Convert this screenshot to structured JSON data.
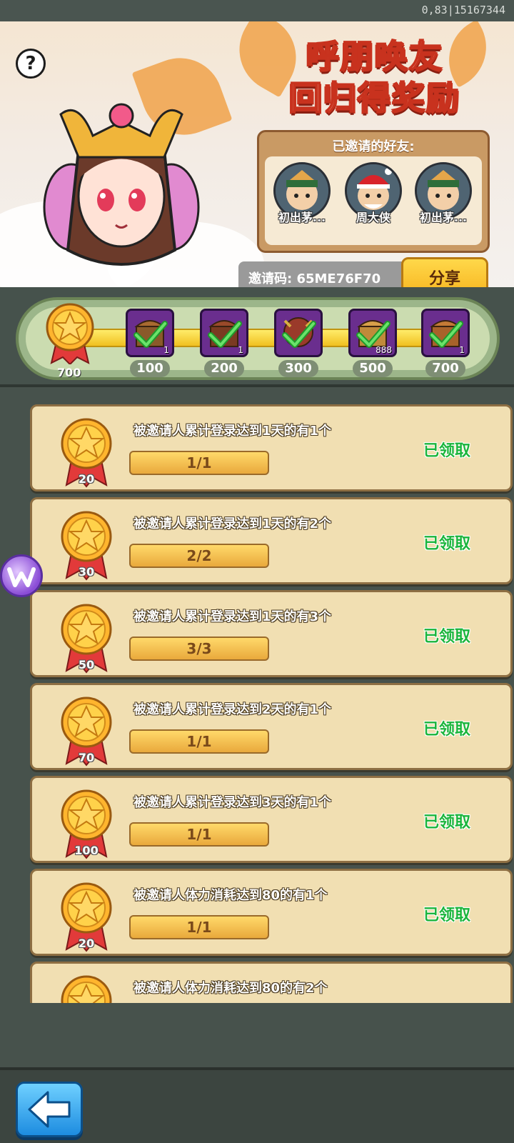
{
  "status_bar": {
    "text": "0,83|15167344"
  },
  "banner": {
    "help_label": "?",
    "title_line1": "呼朋唤友",
    "title_line2": "回归得奖励",
    "invited": {
      "title": "已邀请的好友:",
      "friends": [
        {
          "name": "初出茅..."
        },
        {
          "name": "周大侠"
        },
        {
          "name": "初出茅..."
        }
      ]
    },
    "invite_code": "邀请码: 65ME76F70",
    "share_label": "分享"
  },
  "progress": {
    "total_points": "700",
    "milestones": [
      {
        "points": "100",
        "count": "1",
        "claimed": true
      },
      {
        "points": "200",
        "count": "1",
        "claimed": true
      },
      {
        "points": "300",
        "count": "",
        "claimed": true
      },
      {
        "points": "500",
        "count": "888",
        "claimed": true
      },
      {
        "points": "700",
        "count": "1",
        "claimed": true
      }
    ]
  },
  "tasks": [
    {
      "desc": "被邀请人累计登录达到1天的有1个",
      "progress": "1/1",
      "reward": "20",
      "status": "已领取"
    },
    {
      "desc": "被邀请人累计登录达到1天的有2个",
      "progress": "2/2",
      "reward": "30",
      "status": "已领取"
    },
    {
      "desc": "被邀请人累计登录达到1天的有3个",
      "progress": "3/3",
      "reward": "50",
      "status": "已领取"
    },
    {
      "desc": "被邀请人累计登录达到2天的有1个",
      "progress": "1/1",
      "reward": "70",
      "status": "已领取"
    },
    {
      "desc": "被邀请人累计登录达到3天的有1个",
      "progress": "1/1",
      "reward": "100",
      "status": "已领取"
    },
    {
      "desc": "被邀请人体力消耗达到80的有1个",
      "progress": "1/1",
      "reward": "20",
      "status": "已领取"
    },
    {
      "desc": "被邀请人体力消耗达到80的有2个",
      "progress": "",
      "reward": "",
      "status": ""
    }
  ],
  "icons": {
    "help": "question-mark-icon",
    "medal": "star-medal-icon",
    "chest": "treasure-chest-icon",
    "check": "green-check-icon",
    "back": "back-arrow-icon",
    "floating": "w-logo-icon"
  },
  "colors": {
    "claimed_text": "#1bb53c",
    "card_bg": "#f1dfb2",
    "progress_fill": "#f0c020",
    "title_red": "#c8321e"
  }
}
